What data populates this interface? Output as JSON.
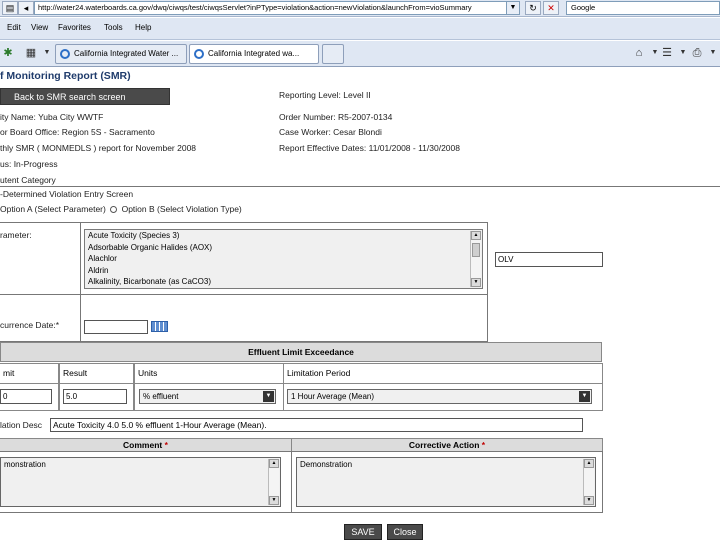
{
  "browser": {
    "address": "http://water24.waterboards.ca.gov/dwq/ciwqs/test/ciwqsServlet?inPType=violation&action=newViolation&launchFrom=vioSummary",
    "search_text": "Google",
    "menu": [
      "Edit",
      "View",
      "Favorites",
      "Tools",
      "Help"
    ],
    "tabs": [
      {
        "label": "California Integrated Water ..."
      },
      {
        "label": "California Integrated wa..."
      }
    ]
  },
  "page": {
    "title": "f Monitoring Report (SMR)",
    "back_button": "Back to SMR search screen",
    "facility": "ity Name: Yuba City WWTF",
    "board_office": "or Board Office: Region 5S - Sacramento",
    "report_desc": "thly SMR ( MONMEDLS ) report for November 2008",
    "status": "us: In-Progress",
    "category": "utent Category",
    "reporting_level": "Reporting Level: Level II",
    "order_number": "Order Number: R5-2007-0134",
    "case_worker": "Case Worker: Cesar Blondi",
    "effective_dates": "Report Effective Dates: 11/01/2008 - 11/30/2008",
    "determined": "-Determined Violation Entry Screen",
    "option_a": "Option A (Select Parameter)",
    "option_b": "Option B (Select Violation Type)",
    "parameter_label": "rameter:",
    "parameters": [
      "Acute Toxicity (Species 3)",
      "Adsorbable Organic Halides (AOX)",
      "Alachlor",
      "Aldrin",
      "Alkalinity, Bicarbonate (as CaCO3)"
    ],
    "side_input": "OLV",
    "occurrence_label": "currence Date:*",
    "occurrence_value": ""
  },
  "exceedance": {
    "header": "Effluent Limit Exceedance",
    "columns": [
      "mit",
      "Result",
      "Units",
      "Limitation Period"
    ],
    "limit_value": "0",
    "result_value": "5.0",
    "units_value": "% effluent",
    "period_value": "1 Hour Average (Mean)"
  },
  "violation_desc": {
    "label": "lation Desc",
    "value": "Acute Toxicity 4.0 5.0 % effluent 1-Hour Average (Mean)."
  },
  "comment": {
    "header": "Comment",
    "required": "*",
    "value": "monstration"
  },
  "corrective": {
    "header": "Corrective Action",
    "required": "*",
    "value": "Demonstration"
  },
  "buttons": {
    "save": "SAVE",
    "close": "Close"
  }
}
